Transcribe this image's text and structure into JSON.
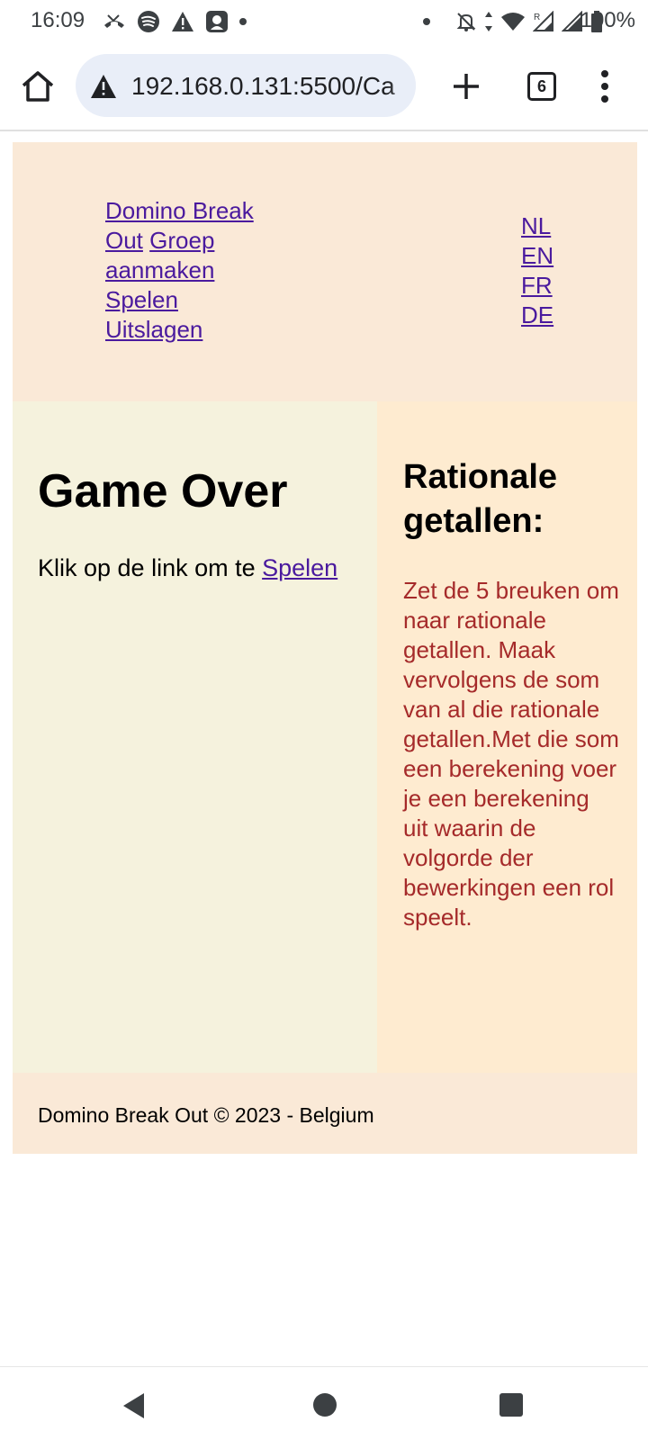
{
  "status_bar": {
    "time": "16:09",
    "battery_text": "100%",
    "left_icons": [
      "missed-call-icon",
      "spotify-icon",
      "warning-icon",
      "app-icon",
      "dot-icon"
    ],
    "right_icons": [
      "dot-icon",
      "mute-icon",
      "data-arrows-icon",
      "wifi-icon",
      "signal-roaming-icon",
      "signal-icon",
      "battery-icon"
    ]
  },
  "browser": {
    "url": "192.168.0.131:5500/Ca",
    "tab_count": "6",
    "icons": [
      "home-icon",
      "warning-icon",
      "plus-icon",
      "tabs-icon",
      "menu-icon"
    ]
  },
  "site_header": {
    "nav_links": [
      "Domino Break Out",
      "Groep aanmaken",
      "Spelen",
      "Uitslagen"
    ],
    "lang_links": [
      "NL",
      "EN",
      "FR",
      "DE"
    ]
  },
  "main": {
    "title": "Game Over",
    "text": "Klik op de link om te ",
    "link": "Spelen"
  },
  "aside": {
    "title": "Rationale getallen:",
    "text": "Zet de 5 breuken om naar rationale getallen. Maak vervolgens de som van al die rationale getallen.Met die som een berekening voer je een berekening uit waarin de volgorde der bewerkingen een rol speelt."
  },
  "footer": {
    "text": "Domino Break Out © 2023 - Belgium"
  },
  "colors": {
    "header_bg": "#fae9d7",
    "main_bg": "#f5f2dd",
    "aside_bg": "#feebd0",
    "aside_text": "#a52a2a",
    "link": "#4a1a9e"
  }
}
